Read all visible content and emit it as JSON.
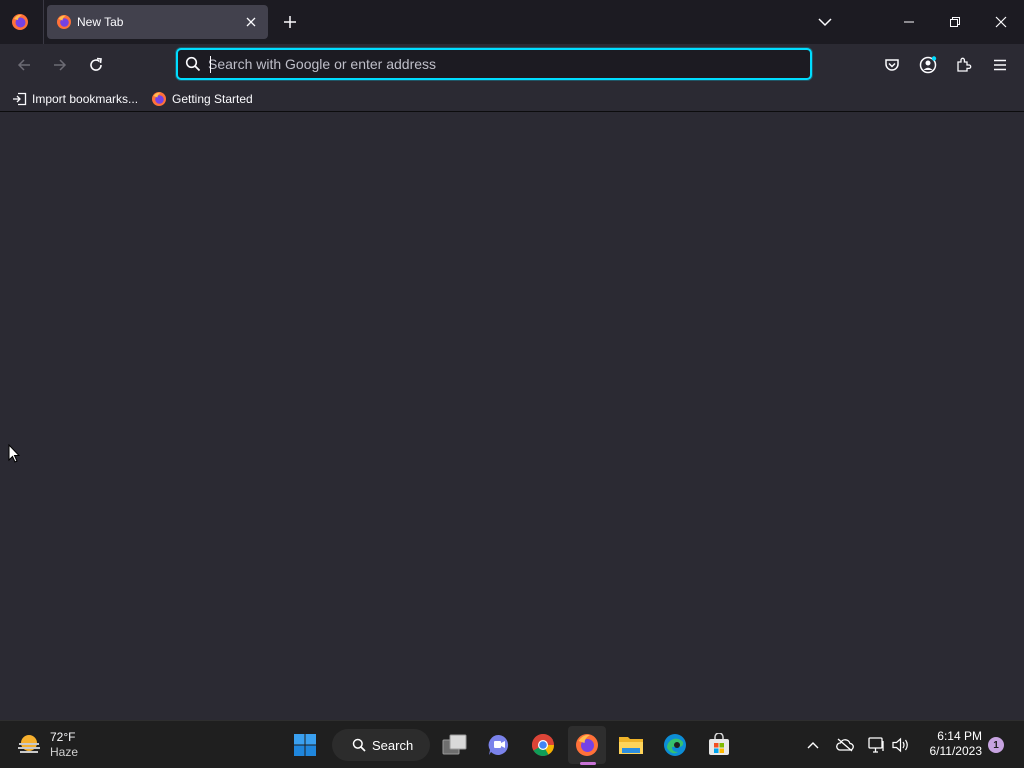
{
  "browser": {
    "tab": {
      "title": "New Tab"
    },
    "urlbar": {
      "placeholder": "Search with Google or enter address",
      "value": ""
    },
    "bookmarks": [
      {
        "label": "Import bookmarks...",
        "icon": "import-icon"
      },
      {
        "label": "Getting Started",
        "icon": "firefox-icon"
      }
    ],
    "accent_color": "#00ddff"
  },
  "taskbar": {
    "weather": {
      "temp": "72°F",
      "condition": "Haze"
    },
    "search_label": "Search",
    "clock": {
      "time": "6:14 PM",
      "date": "6/11/2023"
    },
    "notification_count": "1",
    "pinned_apps": [
      "windows-start",
      "search",
      "task-view",
      "teams-chat",
      "chrome",
      "firefox",
      "file-explorer",
      "edge",
      "microsoft-store"
    ]
  }
}
